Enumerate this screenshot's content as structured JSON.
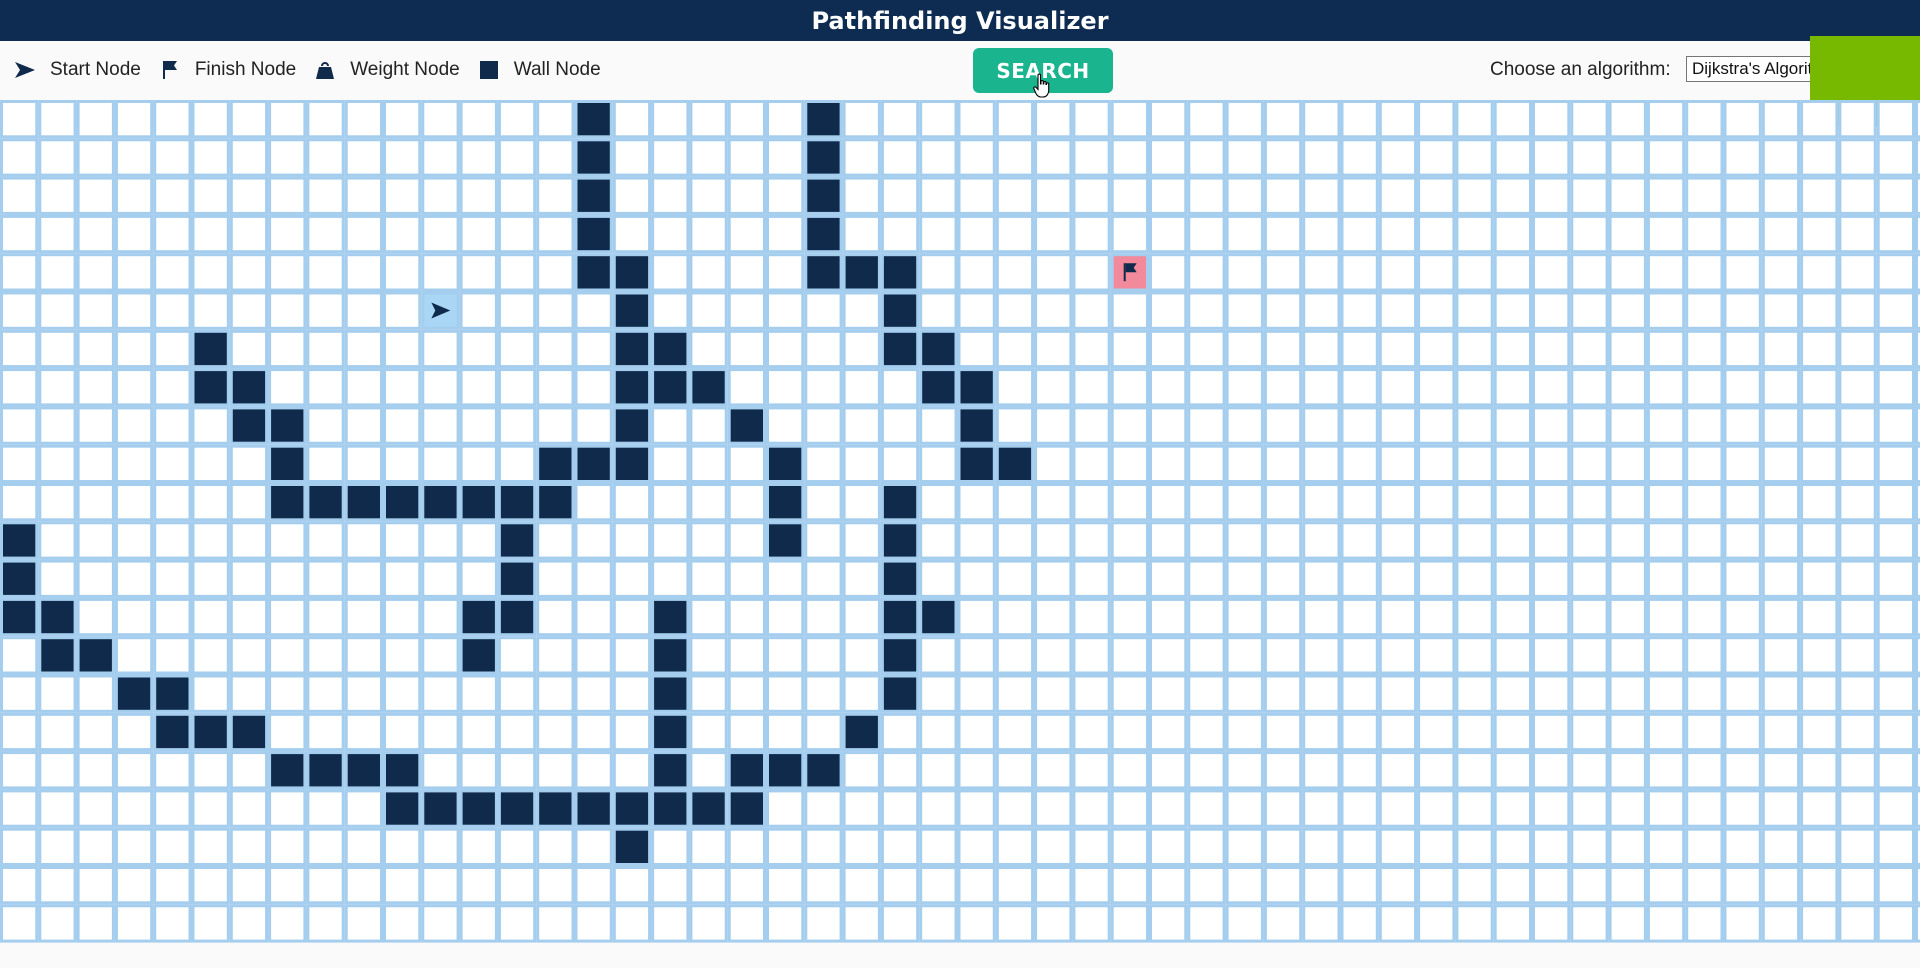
{
  "header": {
    "title": "Pathfinding Visualizer"
  },
  "legend": [
    {
      "icon": "arrow-icon",
      "label": "Start Node"
    },
    {
      "icon": "flag-icon",
      "label": "Finish Node"
    },
    {
      "icon": "weight-icon",
      "label": "Weight Node"
    },
    {
      "icon": "wall-square-icon",
      "label": "Wall Node"
    }
  ],
  "toolbar": {
    "search_label": "SEARCH",
    "algorithm_label": "Choose an algorithm:",
    "algorithm_selected": "Dijkstra's Algorithm"
  },
  "colors": {
    "header_bg": "#0e2b51",
    "wall": "#0f2a4a",
    "grid_line": "#a4cdee",
    "start_bg": "#a9d6f5",
    "finish_bg": "#f28a9c",
    "search_button": "#1ab58f",
    "overlay": "#76b900"
  },
  "grid": {
    "rows": 22,
    "cols": 51,
    "start": {
      "row": 5,
      "col": 11
    },
    "finish": {
      "row": 4,
      "col": 29
    },
    "walls": [
      [
        0,
        15
      ],
      [
        0,
        21
      ],
      [
        1,
        15
      ],
      [
        1,
        21
      ],
      [
        2,
        15
      ],
      [
        2,
        21
      ],
      [
        3,
        15
      ],
      [
        3,
        21
      ],
      [
        4,
        15
      ],
      [
        4,
        16
      ],
      [
        4,
        21
      ],
      [
        4,
        22
      ],
      [
        4,
        23
      ],
      [
        5,
        16
      ],
      [
        5,
        23
      ],
      [
        6,
        5
      ],
      [
        6,
        16
      ],
      [
        6,
        17
      ],
      [
        6,
        23
      ],
      [
        6,
        24
      ],
      [
        7,
        5
      ],
      [
        7,
        6
      ],
      [
        7,
        16
      ],
      [
        7,
        17
      ],
      [
        7,
        18
      ],
      [
        7,
        24
      ],
      [
        7,
        25
      ],
      [
        8,
        6
      ],
      [
        8,
        7
      ],
      [
        8,
        16
      ],
      [
        8,
        19
      ],
      [
        8,
        25
      ],
      [
        9,
        7
      ],
      [
        9,
        14
      ],
      [
        9,
        15
      ],
      [
        9,
        16
      ],
      [
        9,
        20
      ],
      [
        9,
        25
      ],
      [
        9,
        26
      ],
      [
        10,
        7
      ],
      [
        10,
        8
      ],
      [
        10,
        9
      ],
      [
        10,
        10
      ],
      [
        10,
        11
      ],
      [
        10,
        12
      ],
      [
        10,
        13
      ],
      [
        10,
        14
      ],
      [
        10,
        20
      ],
      [
        10,
        23
      ],
      [
        11,
        0
      ],
      [
        11,
        13
      ],
      [
        11,
        20
      ],
      [
        11,
        23
      ],
      [
        12,
        0
      ],
      [
        12,
        13
      ],
      [
        12,
        23
      ],
      [
        13,
        0
      ],
      [
        13,
        1
      ],
      [
        13,
        12
      ],
      [
        13,
        13
      ],
      [
        13,
        17
      ],
      [
        13,
        23
      ],
      [
        13,
        24
      ],
      [
        14,
        1
      ],
      [
        14,
        2
      ],
      [
        14,
        12
      ],
      [
        14,
        17
      ],
      [
        14,
        23
      ],
      [
        15,
        3
      ],
      [
        15,
        4
      ],
      [
        15,
        17
      ],
      [
        15,
        23
      ],
      [
        16,
        4
      ],
      [
        16,
        5
      ],
      [
        16,
        6
      ],
      [
        16,
        17
      ],
      [
        16,
        22
      ],
      [
        17,
        7
      ],
      [
        17,
        8
      ],
      [
        17,
        9
      ],
      [
        17,
        10
      ],
      [
        17,
        17
      ],
      [
        17,
        19
      ],
      [
        17,
        20
      ],
      [
        17,
        21
      ],
      [
        18,
        10
      ],
      [
        18,
        11
      ],
      [
        18,
        12
      ],
      [
        18,
        13
      ],
      [
        18,
        14
      ],
      [
        18,
        15
      ],
      [
        18,
        16
      ],
      [
        18,
        17
      ],
      [
        18,
        18
      ],
      [
        18,
        19
      ],
      [
        19,
        16
      ]
    ]
  }
}
